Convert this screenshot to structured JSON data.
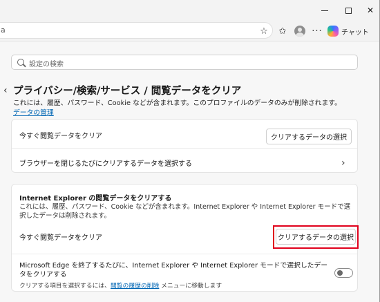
{
  "toolbar": {
    "address_text": "a",
    "copilot_label": "チャット"
  },
  "search": {
    "placeholder": "設定の検索"
  },
  "page": {
    "title": "プライバシー/検索/サービス / 閲覧データをクリア",
    "description": "これには、履歴、パスワード、Cookie などが含まれます。このプロファイルのデータのみが削除されます。",
    "manage_link": "データの管理"
  },
  "card1": {
    "clear_now_label": "今すぐ閲覧データをクリア",
    "choose_button": "クリアするデータの選択",
    "on_close_label": "ブラウザーを閉じるたびにクリアするデータを選択する"
  },
  "card2": {
    "title": "Internet Explorer の閲覧データをクリアする",
    "description": "これには、履歴、パスワード、Cookie などが含まれます。Internet Explorer や Internet Explorer モードで選択したデータは削除されます。",
    "clear_now_label": "今すぐ閲覧データをクリア",
    "choose_button": "クリアするデータの選択",
    "toggle_label": "Microsoft Edge を終了するたびに、Internet Explorer や Internet Explorer モードで選択したデータをクリアする",
    "hint_prefix": "クリアする項目を選択するには、",
    "hint_link": "閲覧の履歴の削除",
    "hint_suffix": " メニューに移動します",
    "toggle_on": false
  },
  "colors": {
    "highlight": "#e0001b",
    "link": "#0066b4"
  }
}
